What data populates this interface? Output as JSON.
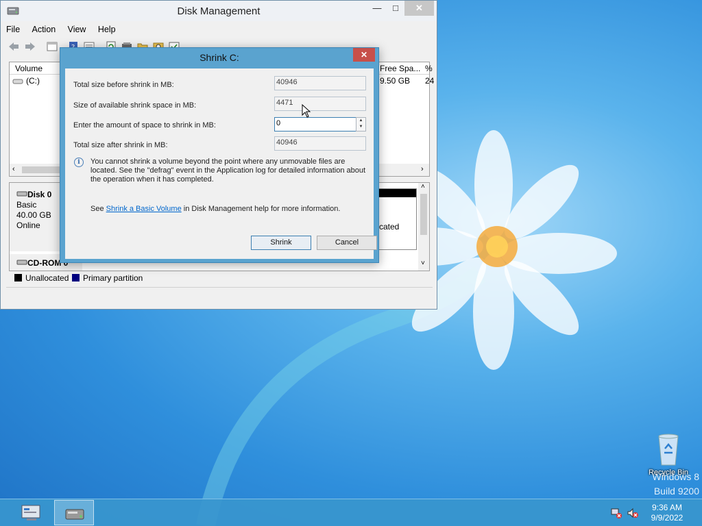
{
  "window": {
    "title": "Disk Management",
    "menu": [
      "File",
      "Action",
      "View",
      "Help"
    ],
    "volume_list": {
      "columns": [
        "Volume",
        "Free Spa...",
        "%"
      ],
      "rows": [
        {
          "volume": "(C:)",
          "free": "9.50 GB",
          "pct": "24"
        }
      ]
    },
    "disk0": {
      "name": "Disk 0",
      "type": "Basic",
      "size": "40.00 GB",
      "status": "Online"
    },
    "cdrom": {
      "name": "CD-ROM 0"
    },
    "partition_fragment": "cated",
    "legend": [
      "Unallocated",
      "Primary partition"
    ]
  },
  "dialog": {
    "title": "Shrink C:",
    "fields": {
      "total_before_label": "Total size before shrink in MB:",
      "total_before_value": "40946",
      "available_label": "Size of available shrink space in MB:",
      "available_value": "4471",
      "enter_label": "Enter the amount of space to shrink in MB:",
      "enter_value": "0",
      "total_after_label": "Total size after shrink in MB:",
      "total_after_value": "40946"
    },
    "info": "You cannot shrink a volume beyond the point where any unmovable files are located. See the \"defrag\" event in the Application log for detailed information about the operation when it has completed.",
    "see_prefix": "See",
    "see_link": "Shrink a Basic Volume",
    "see_suffix": "in Disk Management help for more information.",
    "shrink_button": "Shrink",
    "cancel_button": "Cancel"
  },
  "desktop": {
    "recycle_bin": "Recycle Bin",
    "watermark_line1": "Windows 8",
    "watermark_line2": "Build 9200"
  },
  "taskbar": {
    "time": "9:36 AM",
    "date": "9/9/2022"
  },
  "colors": {
    "unallocated": "#000000",
    "primary_partition": "#00007f",
    "link": "#0066cc",
    "dialog_frame": "#5aa3cf",
    "close_red": "#c7504a"
  }
}
